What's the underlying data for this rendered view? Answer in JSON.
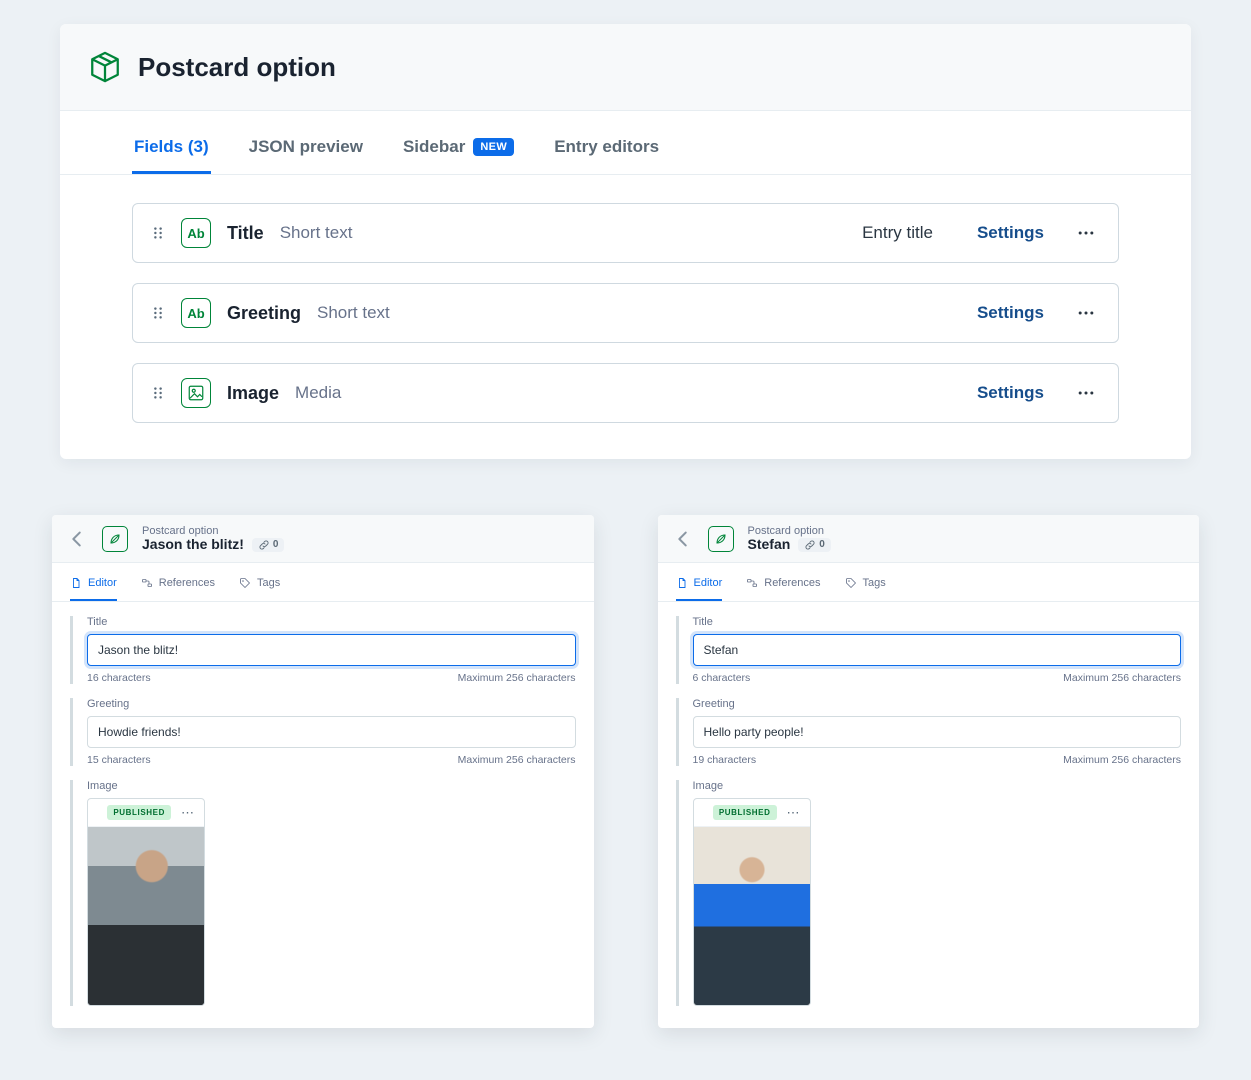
{
  "content_type": {
    "title": "Postcard option",
    "tabs": [
      {
        "label": "Fields (3)",
        "active": true
      },
      {
        "label": "JSON preview",
        "active": false
      },
      {
        "label": "Sidebar",
        "badge": "NEW",
        "active": false
      },
      {
        "label": "Entry editors",
        "active": false
      }
    ],
    "settings_label": "Settings",
    "fields": [
      {
        "name": "Title",
        "kind": "Short text",
        "is_entry_title": true,
        "entry_title_label": "Entry title"
      },
      {
        "name": "Greeting",
        "kind": "Short text",
        "is_entry_title": false
      },
      {
        "name": "Image",
        "kind": "Media",
        "is_entry_title": false
      }
    ]
  },
  "editor_tabs": [
    {
      "label": "Editor",
      "icon": "doc"
    },
    {
      "label": "References",
      "icon": "ref"
    },
    {
      "label": "Tags",
      "icon": "tag"
    }
  ],
  "link_count_label": "0",
  "max_chars_label": "Maximum 256 characters",
  "published_label": "PUBLISHED",
  "editors": [
    {
      "kind": "Postcard option",
      "title": "Jason the blitz!",
      "title_field": {
        "label": "Title",
        "value": "Jason the blitz!",
        "count_label": "16 characters"
      },
      "greeting_field": {
        "label": "Greeting",
        "value": "Howdie friends!",
        "count_label": "15 characters"
      },
      "image_field": {
        "label": "Image"
      }
    },
    {
      "kind": "Postcard option",
      "title": "Stefan",
      "title_field": {
        "label": "Title",
        "value": "Stefan",
        "count_label": "6 characters"
      },
      "greeting_field": {
        "label": "Greeting",
        "value": "Hello party people!",
        "count_label": "19 characters"
      },
      "image_field": {
        "label": "Image"
      }
    }
  ]
}
